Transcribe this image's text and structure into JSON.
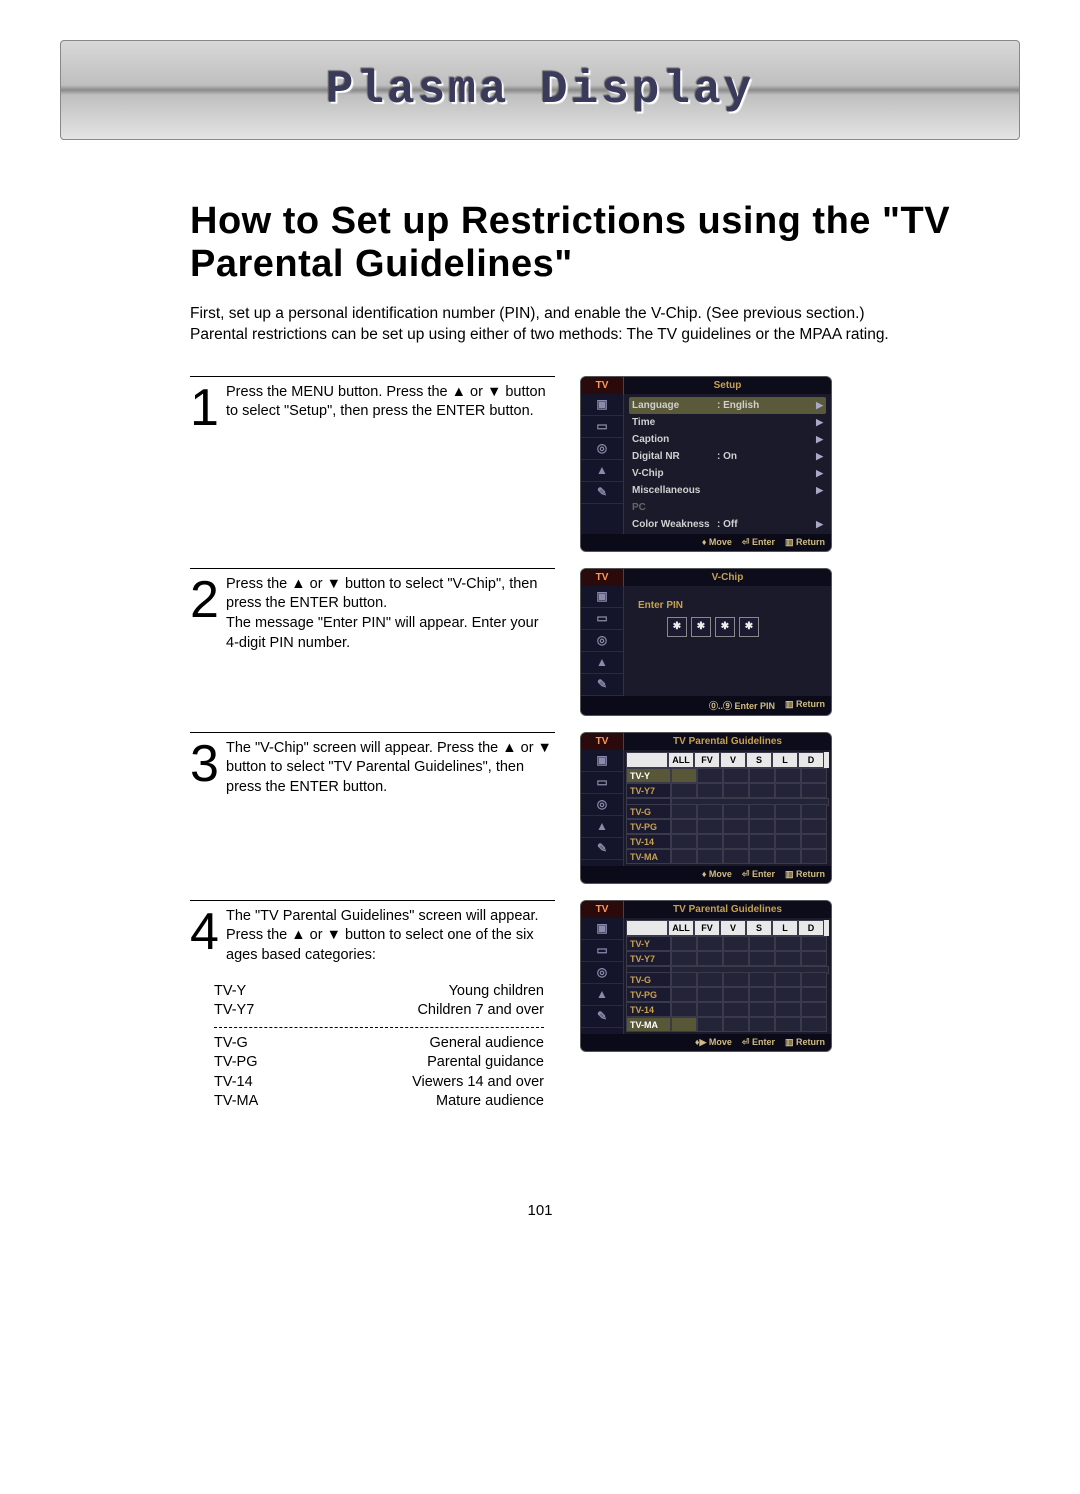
{
  "header": {
    "title": "Plasma Display"
  },
  "page": {
    "title": "How to Set up Restrictions using the \"TV Parental Guidelines\"",
    "intro": "First, set up a personal identification number (PIN), and enable the V-Chip. (See previous section.) Parental restrictions can be set up using either of two methods: The TV guidelines or the MPAA rating.",
    "number": "101"
  },
  "steps": {
    "s1": {
      "num": "1",
      "text": "Press the MENU button. Press the ▲ or ▼ button to select \"Setup\", then press the ENTER button."
    },
    "s2": {
      "num": "2",
      "text": "Press the ▲ or ▼ button to select \"V-Chip\", then press the ENTER button.\nThe message \"Enter PIN\" will appear. Enter your 4-digit PIN number."
    },
    "s3": {
      "num": "3",
      "text": "The \"V-Chip\" screen will appear. Press the ▲ or ▼ button to select \"TV Parental Guidelines\", then press the ENTER button."
    },
    "s4": {
      "num": "4",
      "text": "The \"TV Parental Guidelines\" screen will appear. Press the ▲ or ▼ button to select one of the six ages based categories:"
    }
  },
  "osd": {
    "tv": "TV",
    "setup": {
      "title": "Setup",
      "rows": {
        "language": {
          "label": "Language",
          "value": ": English"
        },
        "time": {
          "label": "Time"
        },
        "caption": {
          "label": "Caption"
        },
        "digital_nr": {
          "label": "Digital NR",
          "value": ": On"
        },
        "vchip": {
          "label": "V-Chip"
        },
        "misc": {
          "label": "Miscellaneous"
        },
        "pc": {
          "label": "PC"
        },
        "color_weak": {
          "label": "Color Weakness",
          "value": ": Off"
        }
      }
    },
    "vchip": {
      "title": "V-Chip",
      "enter_pin": "Enter PIN",
      "star": "✱"
    },
    "tpg": {
      "title": "TV Parental Guidelines",
      "cols": {
        "all": "ALL",
        "fv": "FV",
        "v": "V",
        "s": "S",
        "l": "L",
        "d": "D"
      },
      "rows": {
        "tvy": "TV-Y",
        "tvy7": "TV-Y7",
        "tvg": "TV-G",
        "tvpg": "TV-PG",
        "tv14": "TV-14",
        "tvma": "TV-MA"
      }
    },
    "footer": {
      "move": "Move",
      "enter": "Enter",
      "ret": "Return",
      "enter_pin": "Enter PIN",
      "move_lr": "Move"
    }
  },
  "categories": {
    "tvy": {
      "code": "TV-Y",
      "desc": "Young children"
    },
    "tvy7": {
      "code": "TV-Y7",
      "desc": "Children 7 and over"
    },
    "tvg": {
      "code": "TV-G",
      "desc": "General audience"
    },
    "tvpg": {
      "code": "TV-PG",
      "desc": "Parental guidance"
    },
    "tv14": {
      "code": "TV-14",
      "desc": "Viewers 14 and over"
    },
    "tvma": {
      "code": "TV-MA",
      "desc": "Mature audience"
    }
  }
}
